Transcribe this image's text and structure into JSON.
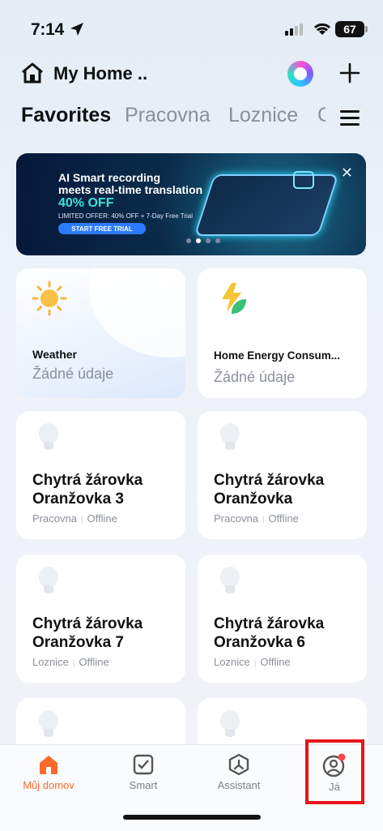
{
  "status_bar": {
    "time": "7:14",
    "battery": "67"
  },
  "header": {
    "title": "My Home .."
  },
  "tabs": [
    "Favorites",
    "Pracovna",
    "Loznice",
    "C"
  ],
  "banner": {
    "line1": "AI Smart recording",
    "line2": "meets real-time translation",
    "offer": "40% OFF",
    "small": "LIMITED OFFER: 40% OFF + 7-Day Free Trial",
    "cta": "START FREE TRIAL",
    "close": "✕"
  },
  "weather": {
    "title": "Weather",
    "value": "Žádné údaje"
  },
  "energy": {
    "title": "Home Energy Consum...",
    "value": "Žádné údaje"
  },
  "devices": [
    {
      "name1": "Chytrá žárovka",
      "name2": "Oranžovka 3",
      "room": "Pracovna",
      "status": "Offline"
    },
    {
      "name1": "Chytrá žárovka",
      "name2": "Oranžovka",
      "room": "Pracovna",
      "status": "Offline"
    },
    {
      "name1": "Chytrá žárovka",
      "name2": "Oranžovka 7",
      "room": "Loznice",
      "status": "Offline"
    },
    {
      "name1": "Chytrá žárovka",
      "name2": "Oranžovka 6",
      "room": "Loznice",
      "status": "Offline"
    }
  ],
  "bottom_nav": [
    {
      "label": "Můj domov",
      "icon": "home-icon"
    },
    {
      "label": "Smart",
      "icon": "smart-check-icon"
    },
    {
      "label": "Assistant",
      "icon": "assistant-icon"
    },
    {
      "label": "Já",
      "icon": "profile-icon"
    }
  ],
  "colors": {
    "accent": "#ff6a2c",
    "highlight": "#e4161b",
    "muted": "#8a8f99"
  }
}
